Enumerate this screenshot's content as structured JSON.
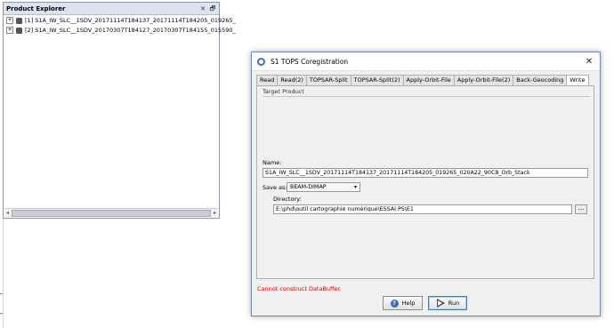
{
  "product_explorer": {
    "title": "Product Explorer",
    "minimize_glyph": "✕",
    "restore_glyph": "🗗",
    "items": [
      {
        "label": "[1] S1A_IW_SLC__1SDV_20171114T184137_20171114T184205_019265_"
      },
      {
        "label": "[2] S1A_IW_SLC__1SDV_20170307T184127_20170307T184155_015590_"
      }
    ]
  },
  "dialog": {
    "title": "S1 TOPS Coregistration",
    "close_glyph": "✕",
    "tabs": [
      {
        "label": "Read"
      },
      {
        "label": "Read(2)"
      },
      {
        "label": "TOPSAR-Split"
      },
      {
        "label": "TOPSAR-Split(2)"
      },
      {
        "label": "Apply-Orbit-File"
      },
      {
        "label": "Apply-Orbit-File(2)"
      },
      {
        "label": "Back-Geocoding"
      },
      {
        "label": "Write"
      }
    ],
    "active_tab": "Write",
    "target_product_label": "Target Product",
    "name_label": "Name:",
    "name_value": "S1A_IW_SLC__1SDV_20171114T184137_20171114T184205_019265_020A22_90C8_Orb_Stack",
    "save_as_label": "Save as:",
    "save_as_value": "BEAM-DIMAP",
    "directory_label": "Directory:",
    "directory_value": "E:\\phd\\outil cartographie numérique\\ESSAI PS\\E1",
    "browse_label": "...",
    "error_message": "Cannot construct DataBuffer.",
    "help_label": "Help",
    "run_label": "Run"
  },
  "colors": {
    "error": "#d10000",
    "accent": "#3c7fb1"
  }
}
